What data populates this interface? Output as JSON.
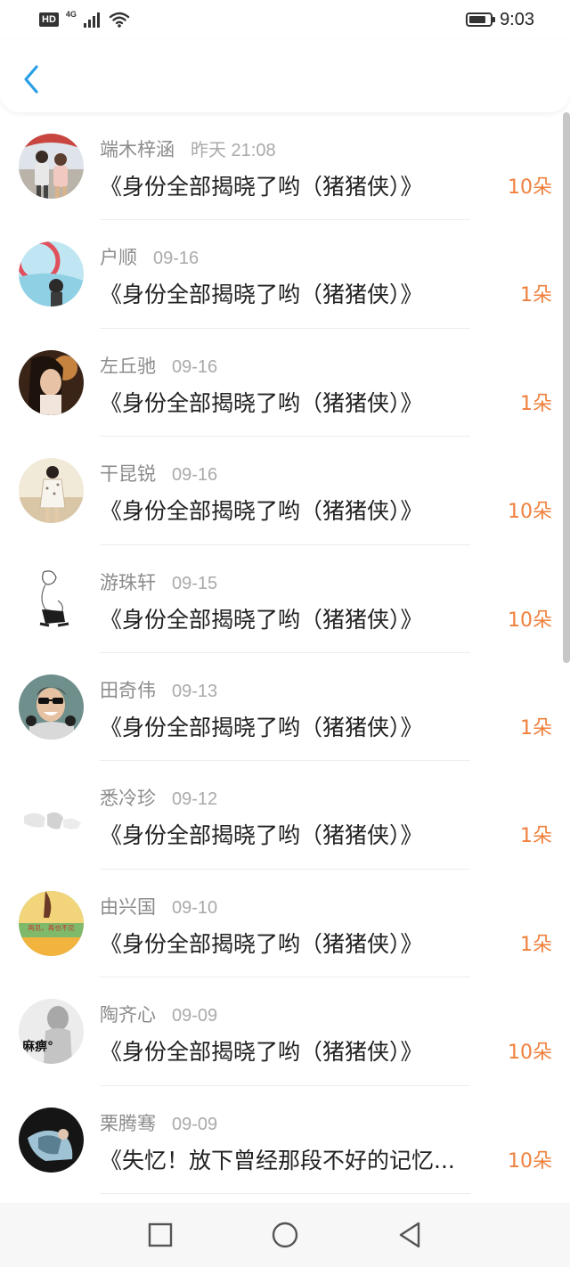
{
  "status_bar": {
    "hd": "HD",
    "network": "4G",
    "time": "9:03"
  },
  "list": [
    {
      "user": "端木梓涵",
      "time": "昨天 21:08",
      "title": "《身份全部揭晓了哟（猪猪侠）》",
      "count": "10朵"
    },
    {
      "user": "户顺",
      "time": "09-16",
      "title": "《身份全部揭晓了哟（猪猪侠）》",
      "count": "1朵"
    },
    {
      "user": "左丘驰",
      "time": "09-16",
      "title": "《身份全部揭晓了哟（猪猪侠）》",
      "count": "1朵"
    },
    {
      "user": "干昆锐",
      "time": "09-16",
      "title": "《身份全部揭晓了哟（猪猪侠）》",
      "count": "10朵"
    },
    {
      "user": "游珠轩",
      "time": "09-15",
      "title": "《身份全部揭晓了哟（猪猪侠）》",
      "count": "10朵"
    },
    {
      "user": "田奇伟",
      "time": "09-13",
      "title": "《身份全部揭晓了哟（猪猪侠）》",
      "count": "1朵"
    },
    {
      "user": "悉冷珍",
      "time": "09-12",
      "title": "《身份全部揭晓了哟（猪猪侠）》",
      "count": "1朵"
    },
    {
      "user": "由兴国",
      "time": "09-10",
      "title": "《身份全部揭晓了哟（猪猪侠）》",
      "count": "1朵"
    },
    {
      "user": "陶齐心",
      "time": "09-09",
      "title": "《身份全部揭晓了哟（猪猪侠）》",
      "count": "10朵"
    },
    {
      "user": "栗腾骞",
      "time": "09-09",
      "title": "《失忆！放下曾经那段不好的记忆...",
      "count": "10朵"
    }
  ],
  "avatar_texts": {
    "item_7": "再见，再也不见",
    "item_8": "麻痹°"
  },
  "colors": {
    "accent": "#2a9fe6",
    "flower_count": "#f0803c"
  },
  "icons": {
    "back": "chevron-left-icon",
    "recent": "square-icon",
    "home": "circle-icon",
    "nav_back": "triangle-back-icon"
  }
}
